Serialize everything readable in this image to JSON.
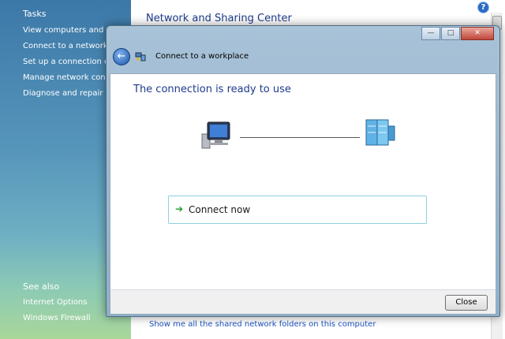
{
  "background_window": {
    "sidebar": {
      "tasks_heading": "Tasks",
      "tasks": [
        "View computers and dev",
        "Connect to a network",
        "Set up a connection or n",
        "Manage network connec",
        "Diagnose and repair"
      ],
      "see_also_heading": "See also",
      "see_also": [
        "Internet Options",
        "Windows Firewall"
      ]
    },
    "title": "Network and Sharing Center",
    "help": "?",
    "bottom_link": "Show me all the shared network folders on this computer"
  },
  "dialog": {
    "title": "Connect to a workplace",
    "controls": {
      "minimize": "—",
      "maximize": "□",
      "close": "✕"
    },
    "heading": "The connection is ready to use",
    "connect_button": "Connect now",
    "close_button": "Close",
    "colors": {
      "heading": "#1e3a8c",
      "link": "#1e56c4",
      "arrow": "#1e9a2a"
    }
  }
}
